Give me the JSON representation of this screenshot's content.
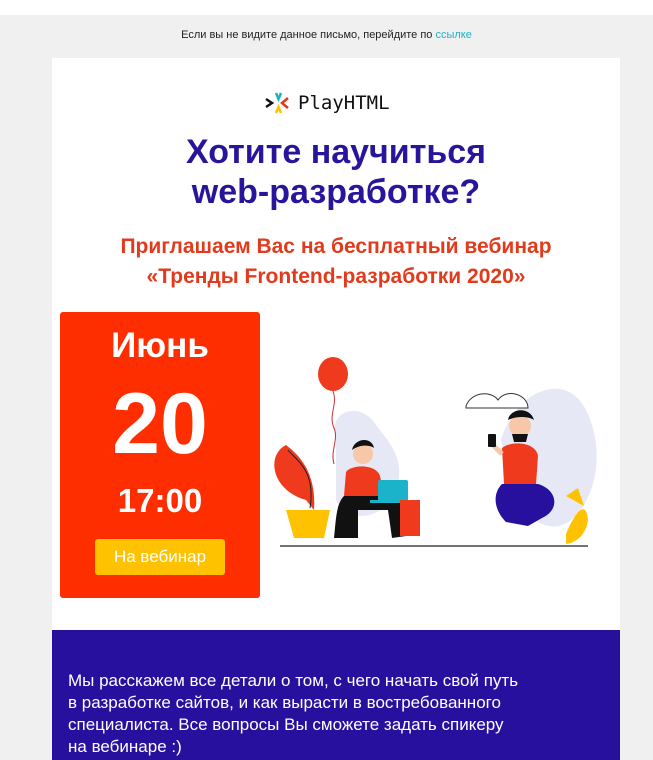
{
  "preheader": {
    "text": "Если вы не видите данное письмо, перейдите по",
    "link": "ссылке"
  },
  "logo": {
    "name": "PlayHTML"
  },
  "headline": {
    "line1": "Хотите научиться",
    "line2": "web-разработке?"
  },
  "subhead": {
    "line1": "Приглашаем Вас на бесплатный вебинар",
    "line2": "«Тренды Frontend-разработки 2020»"
  },
  "event": {
    "month": "Июнь",
    "day": "20",
    "time": "17:00",
    "cta_label": "На вебинар"
  },
  "footer": {
    "line1": "Мы расскажем все детали о том, с чего начать свой путь",
    "line2": "в разработке сайтов, и как вырасти в востребованного",
    "line3": "специалиста. Все вопросы Вы сможете задать спикеру",
    "line4": "на вебинаре :)"
  },
  "colors": {
    "headline": "#27159b",
    "subhead": "#e23a1c",
    "date_bg": "#ff2e00",
    "cta_bg": "#ffc200",
    "footer_bg": "#27109e",
    "link": "#1ab3c9"
  },
  "icons": [
    "playhtml-logo-icon",
    "balloon-illustration",
    "people-illustration"
  ]
}
